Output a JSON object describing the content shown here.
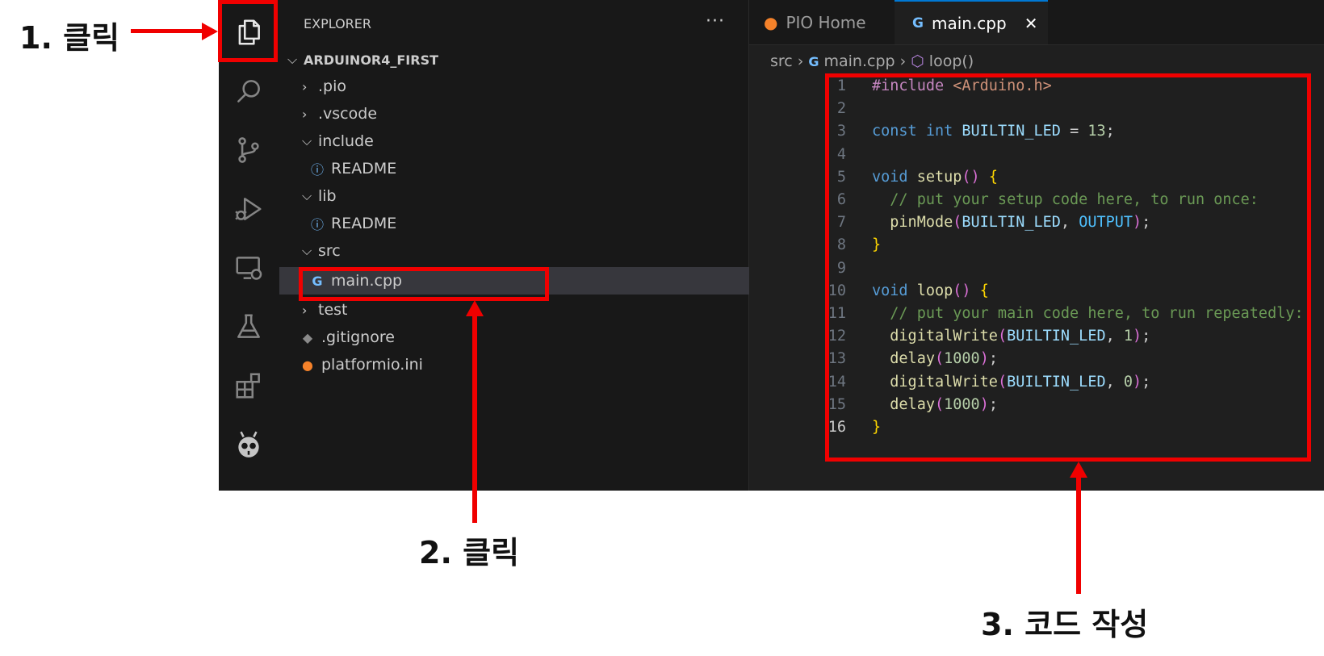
{
  "annotations": {
    "step1": "1. 클릭",
    "step2": "2. 클릭",
    "step3": "3. 코드 작성"
  },
  "activity_bar": [
    {
      "name": "explorer-icon",
      "active": true
    },
    {
      "name": "search-icon"
    },
    {
      "name": "source-control-icon"
    },
    {
      "name": "run-debug-icon"
    },
    {
      "name": "remote-explorer-icon"
    },
    {
      "name": "testing-icon"
    },
    {
      "name": "extensions-icon"
    },
    {
      "name": "platformio-icon"
    }
  ],
  "sidebar": {
    "title": "EXPLORER",
    "more": "···",
    "project": "ARDUINOR4_FIRST",
    "items": [
      {
        "label": ".pio",
        "kind": "folder",
        "expanded": false
      },
      {
        "label": ".vscode",
        "kind": "folder",
        "expanded": false
      },
      {
        "label": "include",
        "kind": "folder",
        "expanded": true
      },
      {
        "label": "README",
        "kind": "info-file"
      },
      {
        "label": "lib",
        "kind": "folder",
        "expanded": true
      },
      {
        "label": "README",
        "kind": "info-file"
      },
      {
        "label": "src",
        "kind": "folder",
        "expanded": true
      },
      {
        "label": "main.cpp",
        "kind": "cpp-file",
        "selected": true
      },
      {
        "label": "test",
        "kind": "folder",
        "expanded": false
      },
      {
        "label": ".gitignore",
        "kind": "git-file"
      },
      {
        "label": "platformio.ini",
        "kind": "pio-file"
      }
    ]
  },
  "tabs": [
    {
      "label": "PIO Home",
      "active": false
    },
    {
      "label": "main.cpp",
      "active": true,
      "close": "✕"
    }
  ],
  "breadcrumb": {
    "folder": "src",
    "file": "main.cpp",
    "symbol": "loop()"
  },
  "code": {
    "current_line": 16,
    "lines": [
      "#include <Arduino.h>",
      "",
      "const int BUILTIN_LED = 13;",
      "",
      "void setup() {",
      "  // put your setup code here, to run once:",
      "  pinMode(BUILTIN_LED, OUTPUT);",
      "}",
      "",
      "void loop() {",
      "  // put your main code here, to run repeatedly:",
      "  digitalWrite(BUILTIN_LED, 1);",
      "  delay(1000);",
      "  digitalWrite(BUILTIN_LED, 0);",
      "  delay(1000);",
      "}"
    ]
  },
  "colors": {
    "annotation_red": "#f00000",
    "accent": "#0078d4",
    "editor_bg": "#1f1f1f"
  }
}
